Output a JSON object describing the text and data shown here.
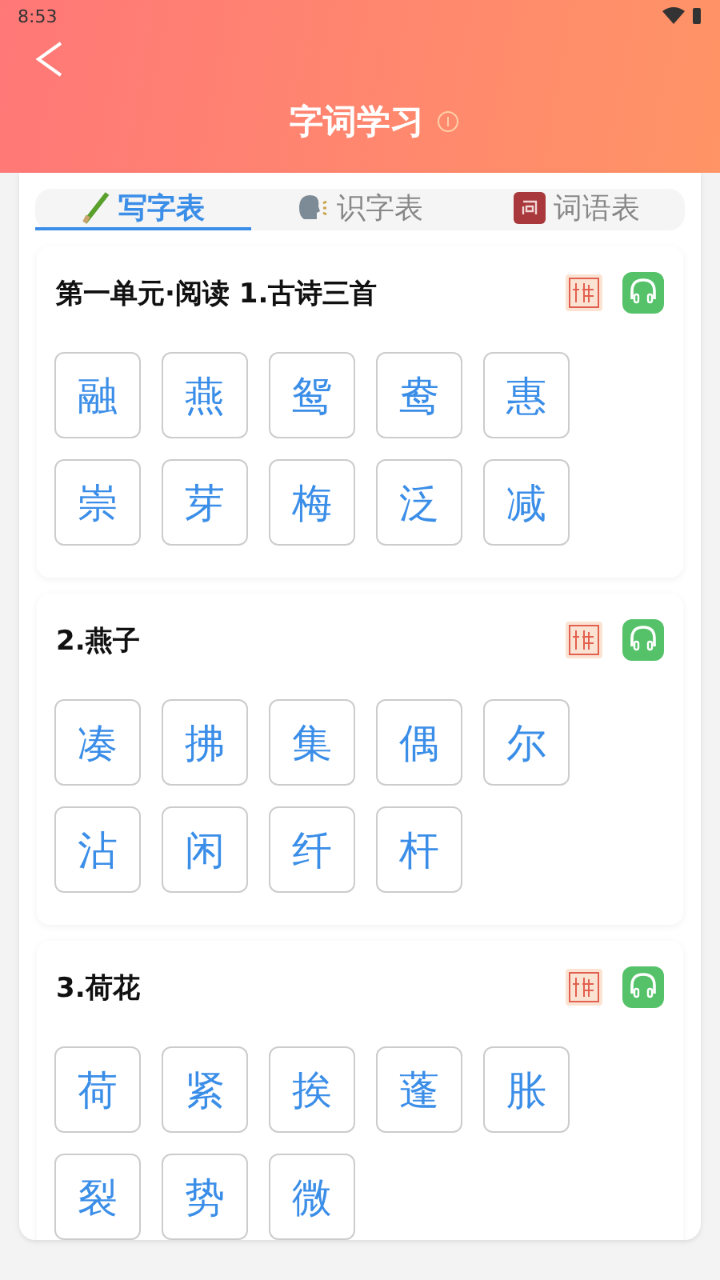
{
  "status_bar": {
    "time": "8:53"
  },
  "header": {
    "title": "字词学习"
  },
  "tabs": [
    {
      "label": "写字表",
      "kind": "pencil",
      "selected": true
    },
    {
      "label": "识字表",
      "kind": "speak",
      "selected": false
    },
    {
      "label": "词语表",
      "kind": "book",
      "selected": false
    }
  ],
  "sections": [
    {
      "title": "第一单元·阅读 1.古诗三首",
      "characters": [
        "融",
        "燕",
        "鸳",
        "鸯",
        "惠",
        "崇",
        "芽",
        "梅",
        "泛",
        "减"
      ]
    },
    {
      "title": "2.燕子",
      "characters": [
        "凑",
        "拂",
        "集",
        "偶",
        "尔",
        "沾",
        "闲",
        "纤",
        "杆"
      ]
    },
    {
      "title": "3.荷花",
      "characters": [
        "荷",
        "紧",
        "挨",
        "蓬",
        "胀",
        "裂",
        "势",
        "微"
      ]
    }
  ]
}
